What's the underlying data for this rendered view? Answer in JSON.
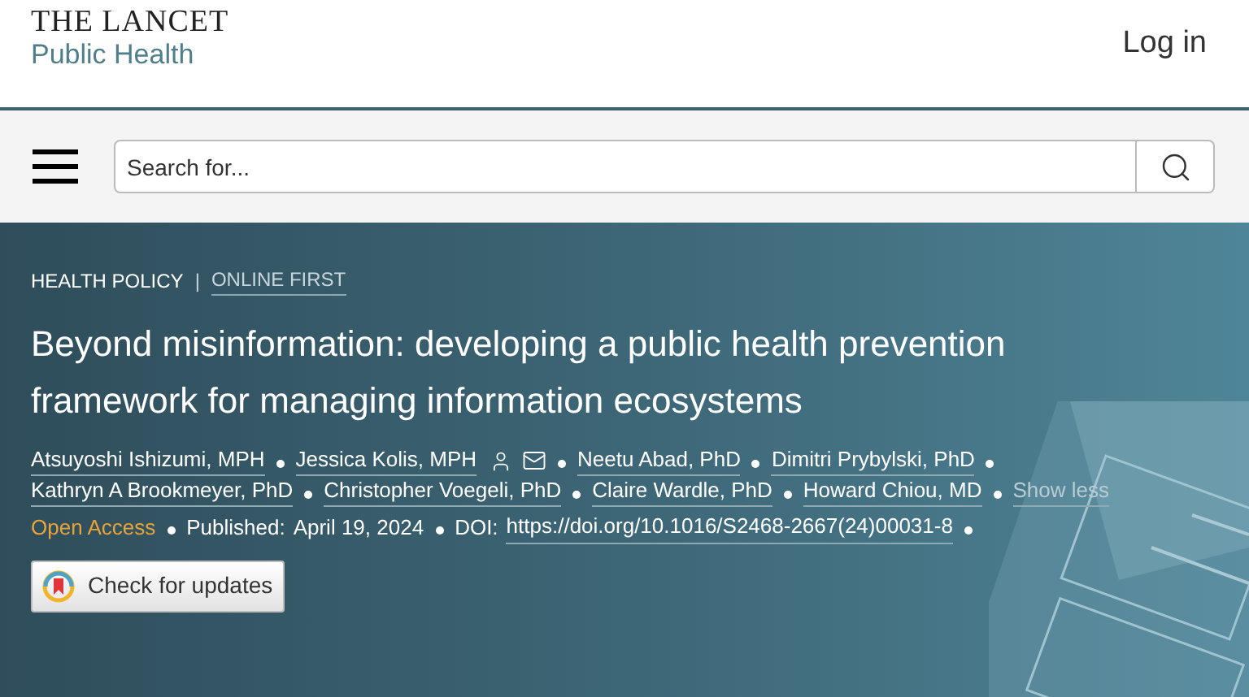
{
  "header": {
    "logo_top": "THE LANCET",
    "logo_bottom": "Public Health",
    "login": "Log in"
  },
  "toolbar": {
    "search": {
      "placeholder": "Search for..."
    }
  },
  "article": {
    "section": "HEALTH POLICY",
    "separator": "|",
    "status": "ONLINE FIRST",
    "title": "Beyond misinformation: developing a public health prevention framework for managing information ecosystems",
    "authors": [
      {
        "name": "Atsuyoshi Ishizumi, MPH",
        "contact": false
      },
      {
        "name": "Jessica Kolis, MPH",
        "contact": true
      },
      {
        "name": "Neetu Abad, PhD",
        "contact": false
      },
      {
        "name": "Dimitri Prybylski, PhD",
        "contact": false
      },
      {
        "name": "Kathryn A Brookmeyer, PhD",
        "contact": false
      },
      {
        "name": "Christopher Voegeli, PhD",
        "contact": false
      },
      {
        "name": "Claire Wardle, PhD",
        "contact": false
      },
      {
        "name": "Howard Chiou, MD",
        "contact": false
      }
    ],
    "show_less": "Show less",
    "access": "Open Access",
    "published_label": "Published:",
    "published_date": "April 19, 2024",
    "doi_label": "DOI:",
    "doi": "https://doi.org/10.1016/S2468-2667(24)00031-8",
    "check_button": "Check for updates"
  }
}
